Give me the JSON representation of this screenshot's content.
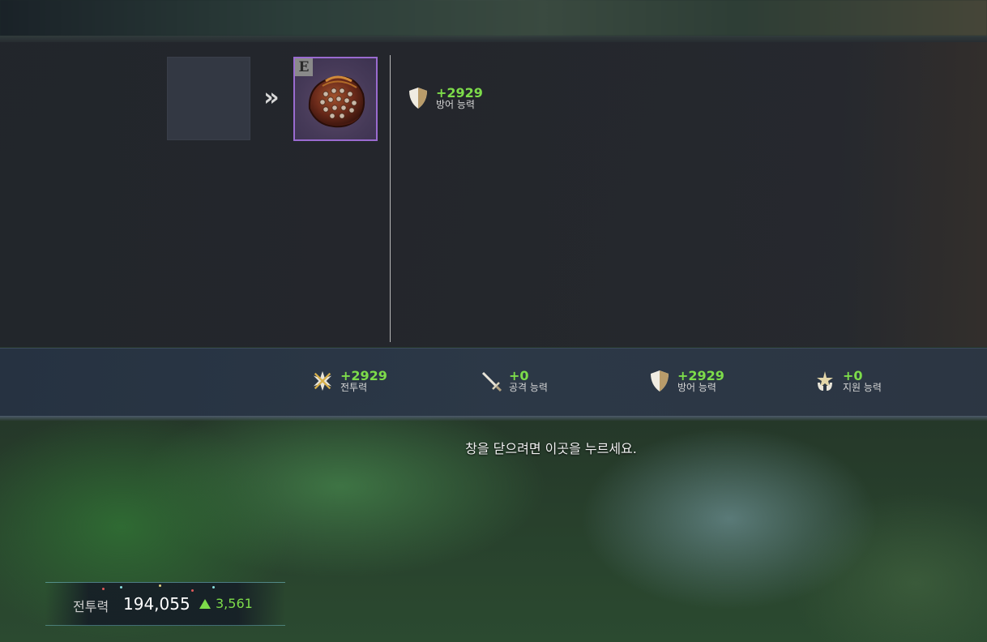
{
  "compare": {
    "item_grade": "E",
    "item_stat": {
      "value": "+2929",
      "label": "방어 능력",
      "icon": "shield-icon"
    }
  },
  "summary": [
    {
      "value": "+2929",
      "label": "전투력",
      "icon": "crossed-swords-icon"
    },
    {
      "value": "+0",
      "label": "공격 능력",
      "icon": "sword-icon"
    },
    {
      "value": "+2929",
      "label": "방어 능력",
      "icon": "shield-icon"
    },
    {
      "value": "+0",
      "label": "지원 능력",
      "icon": "support-star-icon"
    }
  ],
  "close_hint": "창을 닫으려면 이곳을 누르세요.",
  "combat_power": {
    "label": "전투력",
    "value": "194,055",
    "delta": "3,561"
  },
  "colors": {
    "positive": "#7ddc4a",
    "item_border": "#9a6bd0"
  }
}
